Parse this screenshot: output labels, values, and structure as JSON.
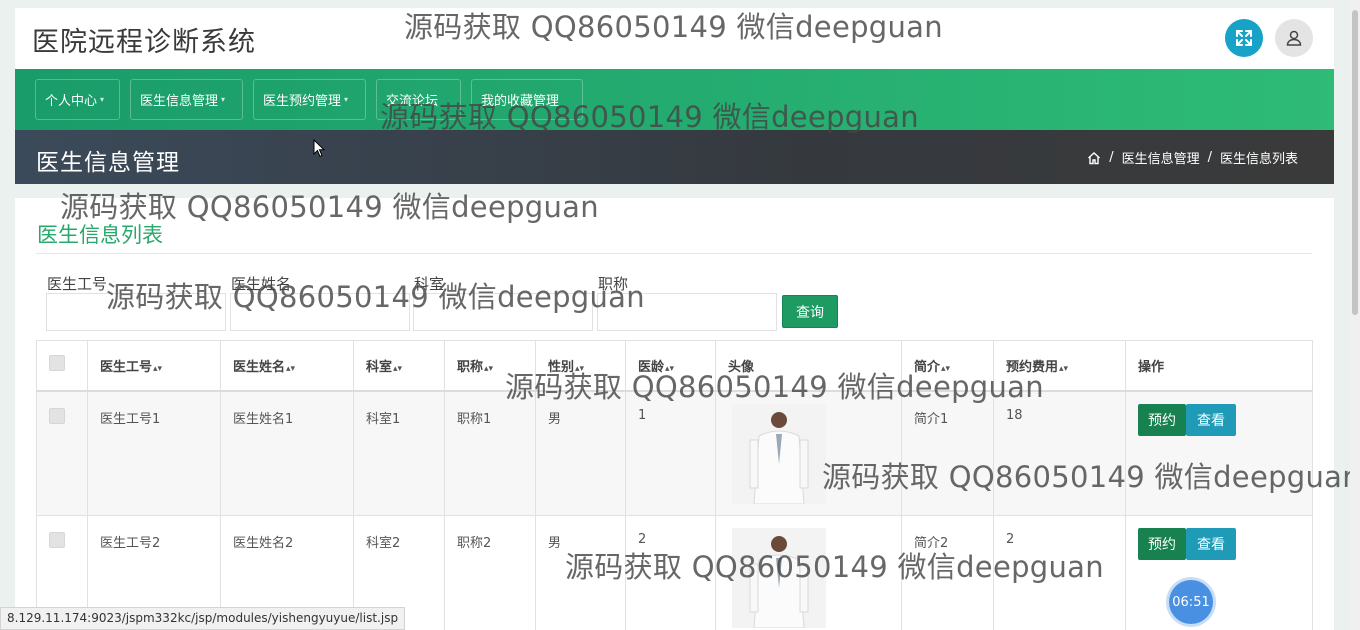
{
  "app": {
    "title": "医院远程诊断系统"
  },
  "nav": [
    {
      "label": "个人中心",
      "has_caret": true
    },
    {
      "label": "医生信息管理",
      "has_caret": true
    },
    {
      "label": "医生预约管理",
      "has_caret": true
    },
    {
      "label": "交流论坛",
      "has_caret": false
    },
    {
      "label": "我的收藏管理",
      "has_caret": false
    }
  ],
  "banner": {
    "title": "医生信息管理",
    "breadcrumb": [
      "医生信息管理",
      "医生信息列表"
    ],
    "separator": "/"
  },
  "panel": {
    "title": "医生信息列表"
  },
  "search": {
    "fields": [
      {
        "label": "医生工号",
        "value": ""
      },
      {
        "label": "医生姓名",
        "value": ""
      },
      {
        "label": "科室",
        "value": ""
      },
      {
        "label": "职称",
        "value": ""
      }
    ],
    "button": "查询"
  },
  "table": {
    "headers": [
      "医生工号",
      "医生姓名",
      "科室",
      "职称",
      "性别",
      "医龄",
      "头像",
      "简介",
      "预约费用",
      "操作"
    ],
    "sortable": [
      true,
      true,
      true,
      true,
      true,
      true,
      false,
      true,
      true,
      false
    ],
    "rows": [
      {
        "id": "医生工号1",
        "name": "医生姓名1",
        "dept": "科室1",
        "title": "职称1",
        "gender": "男",
        "years": "1",
        "intro": "简介1",
        "fee": "18"
      },
      {
        "id": "医生工号2",
        "name": "医生姓名2",
        "dept": "科室2",
        "title": "职称2",
        "gender": "男",
        "years": "2",
        "intro": "简介2",
        "fee": "2"
      }
    ],
    "actions": {
      "book": "预约",
      "view": "查看"
    }
  },
  "watermark": "源码获取 QQ86050149 微信deepguan",
  "status_url": "8.129.11.174:9023/jspm332kc/jsp/modules/yishengyuyue/list.jsp",
  "timer": "06:51",
  "colors": {
    "accent": "#29a86b",
    "nav_green": "#2ebb76",
    "btn_green": "#17814f",
    "btn_blue": "#1f9bb8",
    "fullscreen": "#17a2c8"
  }
}
